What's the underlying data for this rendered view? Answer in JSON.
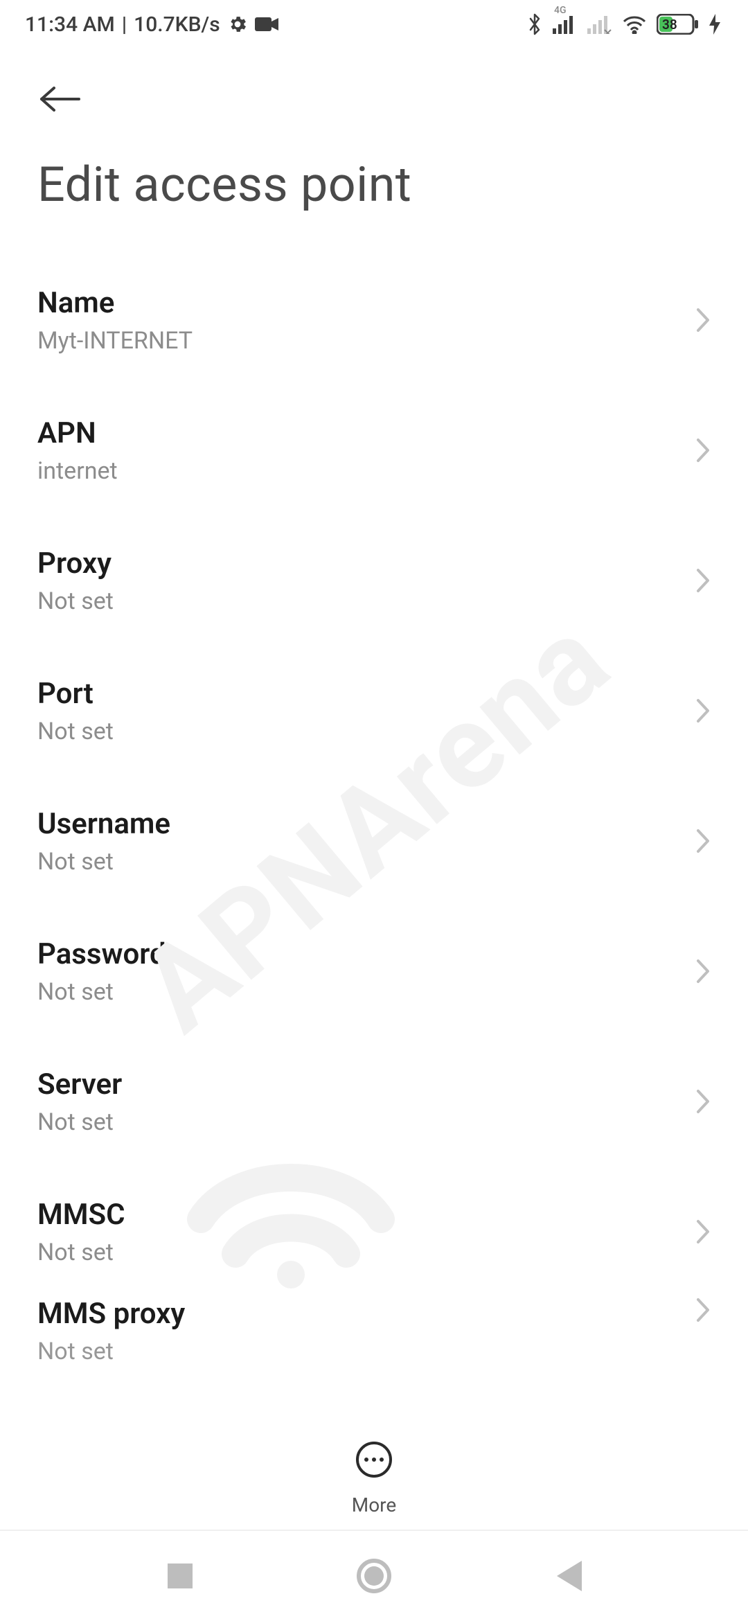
{
  "status_bar": {
    "time": "11:34 AM",
    "speed": "10.7KB/s",
    "network_type": "4G",
    "battery_percent": "38"
  },
  "header": {
    "page_title": "Edit access point"
  },
  "settings": {
    "rows": [
      {
        "key": "name",
        "title": "Name",
        "value": "Myt-INTERNET"
      },
      {
        "key": "apn",
        "title": "APN",
        "value": "internet"
      },
      {
        "key": "proxy",
        "title": "Proxy",
        "value": "Not set"
      },
      {
        "key": "port",
        "title": "Port",
        "value": "Not set"
      },
      {
        "key": "username",
        "title": "Username",
        "value": "Not set"
      },
      {
        "key": "password",
        "title": "Password",
        "value": "Not set"
      },
      {
        "key": "server",
        "title": "Server",
        "value": "Not set"
      },
      {
        "key": "mmsc",
        "title": "MMSC",
        "value": "Not set"
      },
      {
        "key": "mms_proxy",
        "title": "MMS proxy",
        "value": "Not set"
      }
    ]
  },
  "bottom": {
    "more_label": "More"
  },
  "watermark": {
    "text": "APNArena"
  }
}
